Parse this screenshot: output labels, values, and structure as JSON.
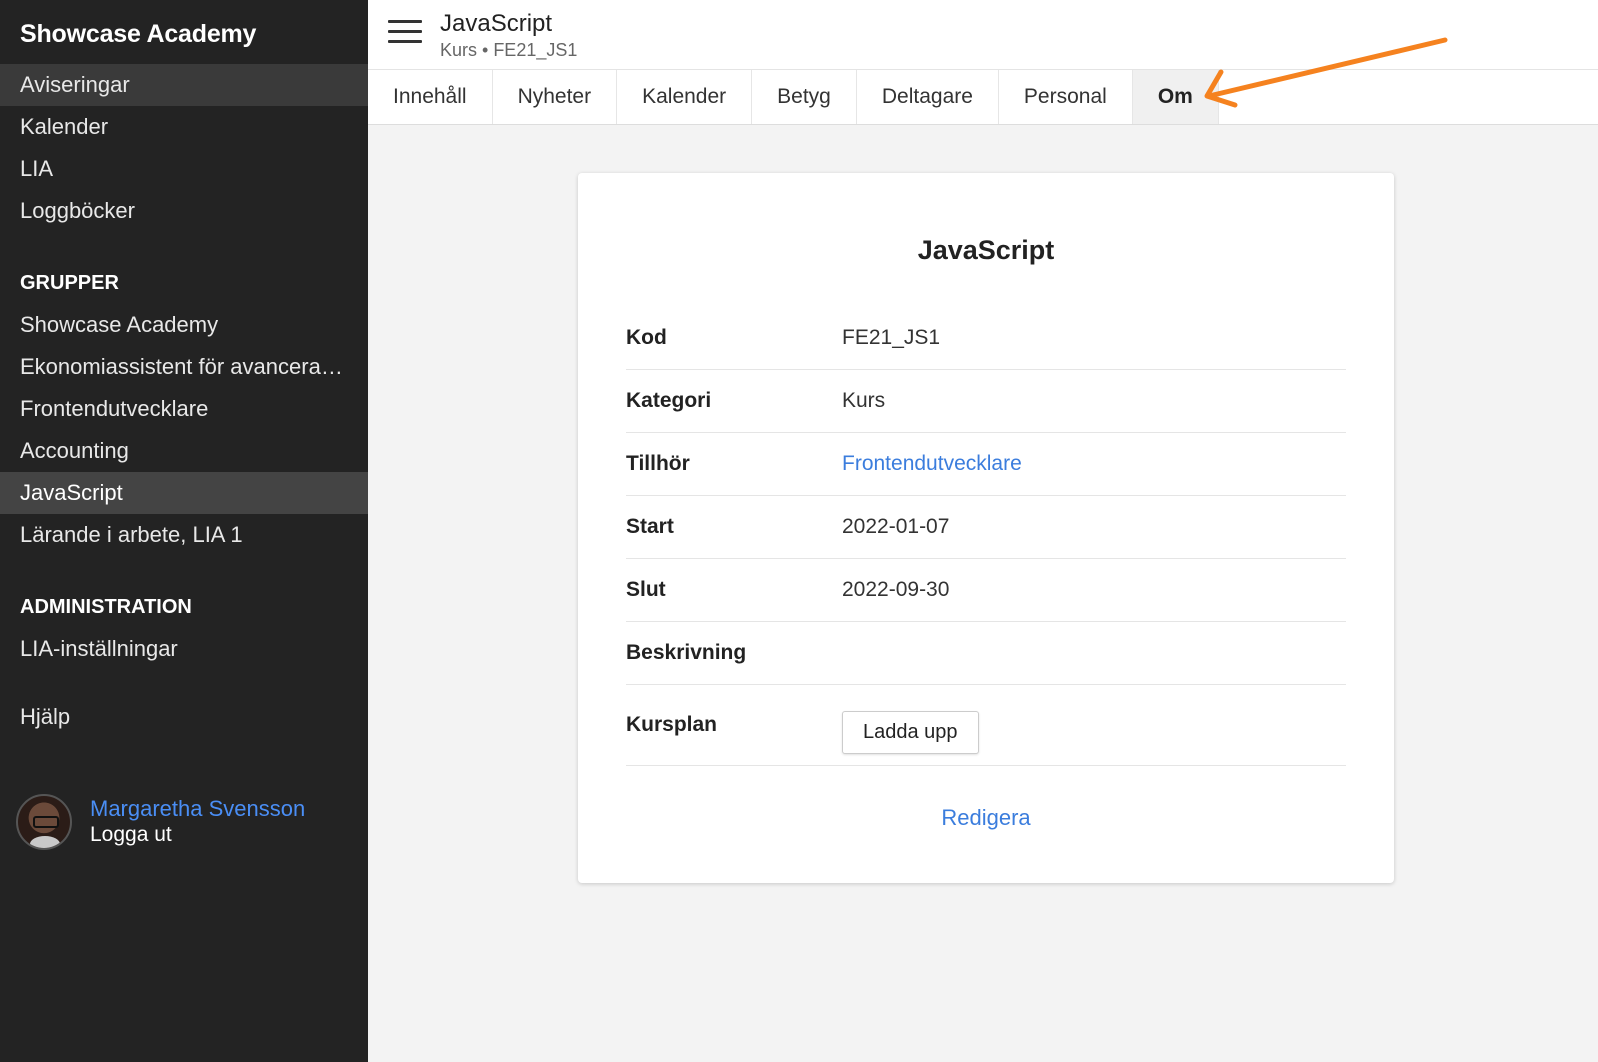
{
  "sidebar": {
    "brand": "Showcase Academy",
    "items": [
      {
        "label": "Aviseringar"
      },
      {
        "label": "Kalender"
      },
      {
        "label": "LIA"
      },
      {
        "label": "Loggböcker"
      }
    ],
    "groups_title": "GRUPPER",
    "groups": [
      {
        "label": "Showcase Academy"
      },
      {
        "label": "Ekonomiassistent för avancerad..."
      },
      {
        "label": "Frontendutvecklare"
      },
      {
        "label": "Accounting"
      },
      {
        "label": "JavaScript"
      },
      {
        "label": "Lärande i arbete, LIA 1"
      }
    ],
    "admin_title": "ADMINISTRATION",
    "admin_items": [
      {
        "label": "LIA-inställningar"
      }
    ],
    "help": "Hjälp",
    "user": {
      "name": "Margaretha Svensson",
      "logout": "Logga ut"
    }
  },
  "header": {
    "title": "JavaScript",
    "subtitle": "Kurs • FE21_JS1"
  },
  "tabs": [
    {
      "label": "Innehåll"
    },
    {
      "label": "Nyheter"
    },
    {
      "label": "Kalender"
    },
    {
      "label": "Betyg"
    },
    {
      "label": "Deltagare"
    },
    {
      "label": "Personal"
    },
    {
      "label": "Om"
    }
  ],
  "annotation": {
    "arrow_color": "#f5821f"
  },
  "card": {
    "title": "JavaScript",
    "rows": [
      {
        "label": "Kod",
        "value": "FE21_JS1"
      },
      {
        "label": "Kategori",
        "value": "Kurs"
      },
      {
        "label": "Tillhör",
        "value": "Frontendutvecklare"
      },
      {
        "label": "Start",
        "value": "2022-01-07"
      },
      {
        "label": "Slut",
        "value": "2022-09-30"
      },
      {
        "label": "Beskrivning",
        "value": ""
      },
      {
        "label": "Kursplan",
        "button": "Ladda upp"
      }
    ],
    "edit": "Redigera"
  },
  "colors": {
    "link": "#3b7ddd",
    "sidebar_bg": "#232323",
    "accent_user": "#4a8ef5"
  }
}
